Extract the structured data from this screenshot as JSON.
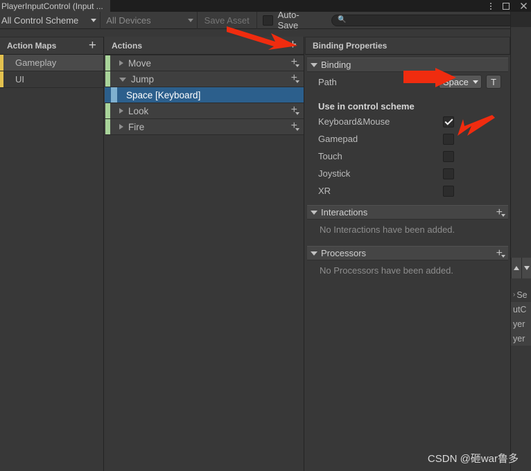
{
  "window": {
    "tab_title": "PlayerInputControl (Input ...",
    "controls": [
      {
        "name": "window-menu-icon",
        "glyph": "kebab-menu-icon"
      },
      {
        "name": "window-maximize-icon",
        "glyph": "maximize-icon"
      },
      {
        "name": "window-close-icon",
        "glyph": "close-icon"
      }
    ]
  },
  "toolbar": {
    "control_scheme_label": "All Control Scheme",
    "devices_label": "All Devices",
    "save_asset_label": "Save Asset",
    "auto_save_label": "Auto-Save",
    "auto_save_checked": false,
    "search_value": "",
    "search_placeholder": "",
    "search_icon": "search-icon"
  },
  "action_maps": {
    "header": "Action Maps",
    "add_label": "+",
    "accent_color": "#e3c14f",
    "items": [
      {
        "label": "Gameplay",
        "selected": true
      },
      {
        "label": "UI",
        "selected": false
      }
    ]
  },
  "actions": {
    "header": "Actions",
    "add_label": "+",
    "accent_color": "#a9d49a",
    "selected_accent_color": "#7fb0cf",
    "selected_row_color": "#2c5f8c",
    "rows": [
      {
        "type": "action",
        "label": "Move",
        "expanded": false,
        "add_label": "+"
      },
      {
        "type": "action",
        "label": "Jump",
        "expanded": true,
        "add_label": "+"
      },
      {
        "type": "binding",
        "label": "Space [Keyboard]",
        "selected": true
      },
      {
        "type": "action",
        "label": "Look",
        "expanded": false,
        "add_label": "+"
      },
      {
        "type": "action",
        "label": "Fire",
        "expanded": false,
        "add_label": "+"
      }
    ]
  },
  "binding_properties": {
    "header": "Binding Properties",
    "binding_section": {
      "title": "Binding",
      "path_label": "Path",
      "path_value": "Space",
      "path_picker_label": "T"
    },
    "control_scheme": {
      "title": "Use in control scheme",
      "options": [
        {
          "label": "Keyboard&Mouse",
          "checked": true
        },
        {
          "label": "Gamepad",
          "checked": false
        },
        {
          "label": "Touch",
          "checked": false
        },
        {
          "label": "Joystick",
          "checked": false
        },
        {
          "label": "XR",
          "checked": false
        }
      ]
    },
    "interactions": {
      "title": "Interactions",
      "add_label": "+",
      "empty_text": "No Interactions have been added."
    },
    "processors": {
      "title": "Processors",
      "add_label": "+",
      "empty_text": "No Processors have been added."
    }
  },
  "inspector_sliver": {
    "rows": [
      {
        "text": "Se",
        "chevron": "›"
      },
      {
        "text": "utC"
      },
      {
        "text": "yer"
      },
      {
        "text": "yer"
      }
    ]
  },
  "annotations": {
    "color": "#f02c0f",
    "arrows": [
      {
        "name": "arrow-to-add-action",
        "target": "actions-add-button"
      },
      {
        "name": "arrow-to-path-dropdown",
        "target": "path-dropdown"
      },
      {
        "name": "arrow-to-keyboard-mouse-checkbox",
        "target": "scheme-checkbox-keyboard-mouse"
      }
    ]
  },
  "watermark": {
    "text": "CSDN @砸war鲁多"
  }
}
